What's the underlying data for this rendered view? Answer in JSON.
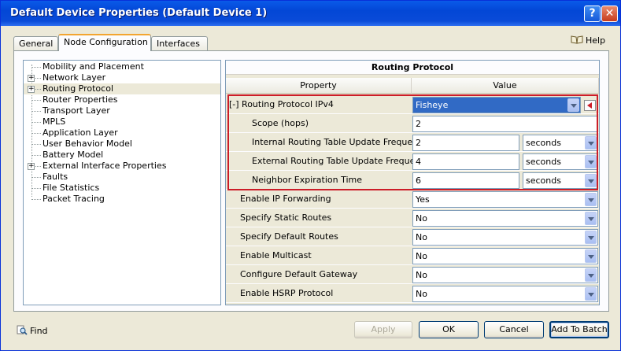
{
  "window": {
    "title": "Default Device Properties (Default Device 1)"
  },
  "tabs": [
    {
      "label": "General"
    },
    {
      "label": "Node Configuration"
    },
    {
      "label": "Interfaces"
    }
  ],
  "help_label": "Help",
  "tree": {
    "items": [
      {
        "label": "Mobility and Placement",
        "expandable": false
      },
      {
        "label": "Network Layer",
        "expandable": true,
        "expander": "+"
      },
      {
        "label": "Routing Protocol",
        "expandable": true,
        "expander": "+",
        "selected": true
      },
      {
        "label": "Router Properties",
        "expandable": false
      },
      {
        "label": "Transport Layer",
        "expandable": false
      },
      {
        "label": "MPLS",
        "expandable": false
      },
      {
        "label": "Application Layer",
        "expandable": false
      },
      {
        "label": "User Behavior Model",
        "expandable": false
      },
      {
        "label": "Battery Model",
        "expandable": false
      },
      {
        "label": "External Interface Properties",
        "expandable": true,
        "expander": "+"
      },
      {
        "label": "Faults",
        "expandable": false
      },
      {
        "label": "File Statistics",
        "expandable": false
      },
      {
        "label": "Packet Tracing",
        "expandable": false
      }
    ]
  },
  "grid": {
    "title": "Routing Protocol",
    "col_property": "Property",
    "col_value": "Value",
    "rows": [
      {
        "label": "[-] Routing Protocol IPv4",
        "value": "Fisheye",
        "type": "select",
        "selected": true
      },
      {
        "label": "Scope (hops)",
        "value": "2",
        "type": "text"
      },
      {
        "label": "Internal Routing Table Update Frequency",
        "value": "2",
        "type": "time",
        "unit": "seconds"
      },
      {
        "label": "External Routing Table Update Frequency",
        "value": "4",
        "type": "time",
        "unit": "seconds"
      },
      {
        "label": "Neighbor Expiration Time",
        "value": "6",
        "type": "time",
        "unit": "seconds"
      },
      {
        "label": "Enable IP Forwarding",
        "value": "Yes",
        "type": "select"
      },
      {
        "label": "Specify Static Routes",
        "value": "No",
        "type": "select"
      },
      {
        "label": "Specify Default Routes",
        "value": "No",
        "type": "select"
      },
      {
        "label": "Enable Multicast",
        "value": "No",
        "type": "select"
      },
      {
        "label": "Configure Default Gateway",
        "value": "No",
        "type": "select"
      },
      {
        "label": "Enable HSRP Protocol",
        "value": "No",
        "type": "select"
      }
    ]
  },
  "footer": {
    "find_label": "Find",
    "apply_label": "Apply",
    "ok_label": "OK",
    "cancel_label": "Cancel",
    "add_to_batch_label": "Add To Batch"
  },
  "icons": {
    "help": "help-book-icon",
    "find": "magnifier-icon",
    "title_help": "question-icon",
    "title_close": "close-icon"
  },
  "colors": {
    "highlight_border": "#cc1d28",
    "selection": "#316ac5",
    "title_bar": "#0347d6"
  }
}
